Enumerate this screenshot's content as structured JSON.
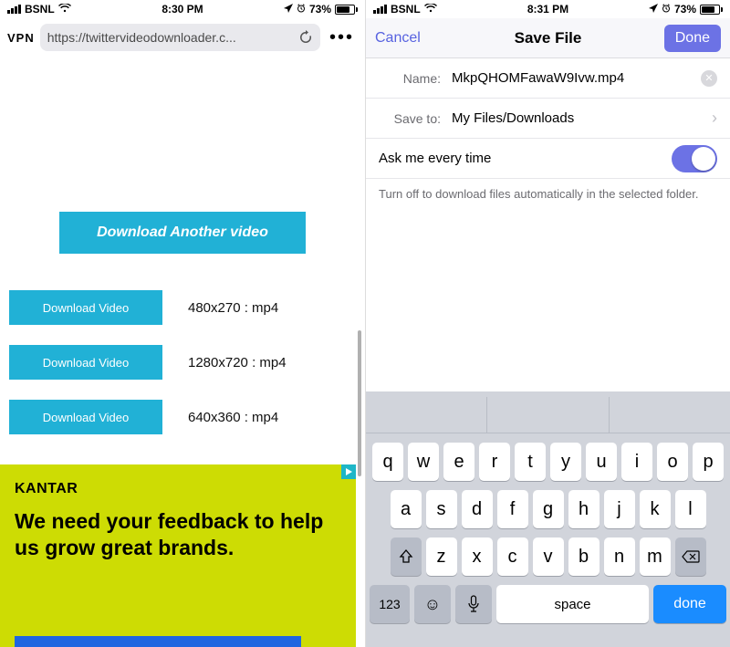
{
  "left": {
    "status": {
      "carrier": "BSNL",
      "time": "8:30 PM",
      "battery": "73%"
    },
    "vpn": "VPN",
    "url": "https://twittervideodownloader.c...",
    "more": "•••",
    "hero_button": "Download Another video",
    "downloads": [
      {
        "button": "Download Video",
        "label": "480x270 : mp4"
      },
      {
        "button": "Download Video",
        "label": "1280x720 : mp4"
      },
      {
        "button": "Download Video",
        "label": "640x360 : mp4"
      }
    ],
    "ad": {
      "brand": "KANTAR",
      "copy": "We need your feedback to help us grow great brands."
    }
  },
  "right": {
    "status": {
      "carrier": "BSNL",
      "time": "8:31 PM",
      "battery": "73%"
    },
    "nav": {
      "cancel": "Cancel",
      "title": "Save File",
      "done": "Done"
    },
    "name_label": "Name:",
    "name_value": "MkpQHOMFawaW9Ivw.mp4",
    "saveto_label": "Save to:",
    "saveto_value": "My Files/Downloads",
    "ask_label": "Ask me every time",
    "ask_on": true,
    "hint": "Turn off to download files automatically in the selected folder.",
    "keyboard": {
      "row1": [
        "q",
        "w",
        "e",
        "r",
        "t",
        "y",
        "u",
        "i",
        "o",
        "p"
      ],
      "row2": [
        "a",
        "s",
        "d",
        "f",
        "g",
        "h",
        "j",
        "k",
        "l"
      ],
      "row3": [
        "z",
        "x",
        "c",
        "v",
        "b",
        "n",
        "m"
      ],
      "numbers": "123",
      "space": "space",
      "done": "done"
    }
  }
}
